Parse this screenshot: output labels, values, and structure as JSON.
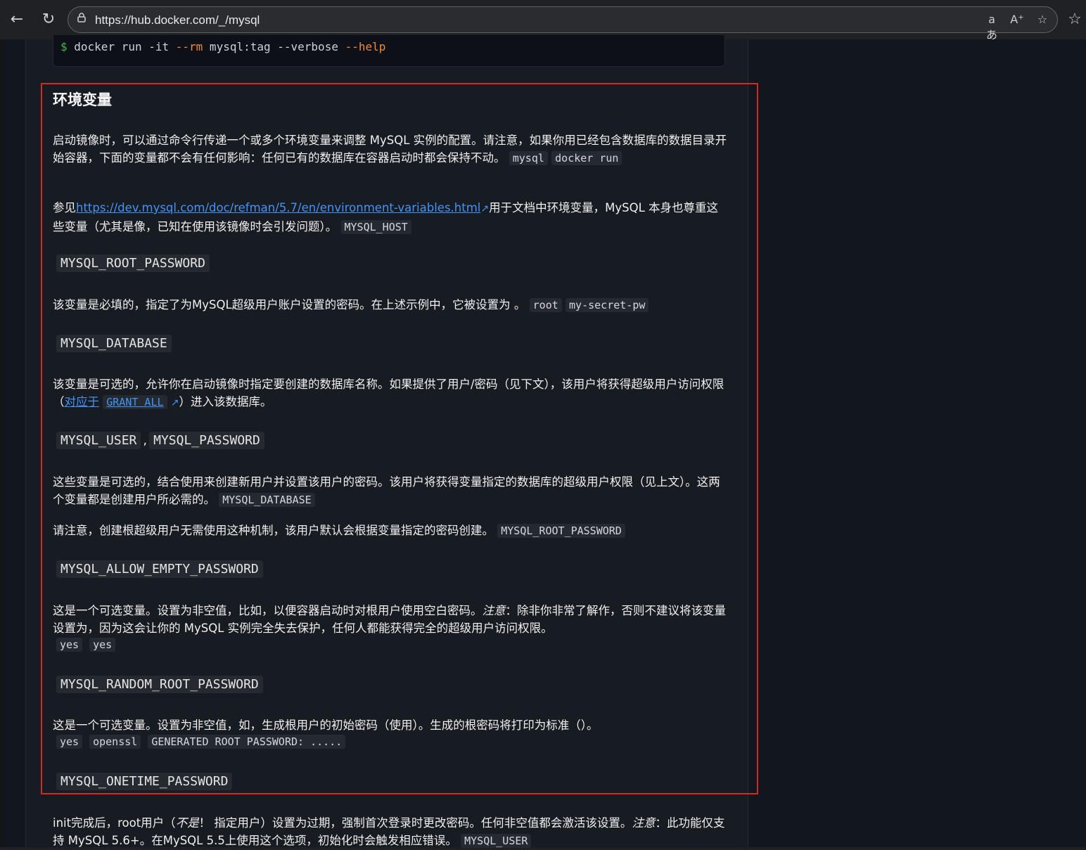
{
  "browser": {
    "url": "https://hub.docker.com/_/mysql",
    "icons": [
      "back-icon",
      "reload-icon",
      "lock-icon",
      "translate-icon",
      "read-aloud-icon",
      "favorite-icon",
      "favorites-list-icon"
    ]
  },
  "code_block": {
    "prompt": "$",
    "cmd_a": " docker run -it ",
    "flag_rm": "--rm",
    "cmd_b": " mysql:tag --verbose ",
    "flag_help": "--help"
  },
  "section": {
    "title": "环境变量",
    "intro_text": "启动镜像时，可以通过命令行传递一个或多个环境变量来调整 MySQL 实例的配置。请注意，如果你用已经包含数据库的数据目录开始容器，下面的变量都不会有任何影响：任何已有的数据库在容器启动时都会保持不动。",
    "intro_code1": "mysql",
    "intro_code2": "docker run",
    "ref_prefix": "参见",
    "ref_link": "https://dev.mysql.com/doc/refman/5.7/en/environment-variables.html",
    "ref_suffix": "用于文档中环境变量，MySQL 本身也尊重这些变量（尤其是像，已知在使用该镜像时会引发问题）。",
    "ref_code": "MYSQL_HOST"
  },
  "vars": {
    "root_password": {
      "name": "MYSQL_ROOT_PASSWORD",
      "desc": "该变量是必填的，指定了为MySQL超级用户账户设置的密码。在上述示例中，它被设置为 。",
      "code1": "root",
      "code2": "my-secret-pw"
    },
    "database": {
      "name": "MYSQL_DATABASE",
      "desc_a": "该变量是可选的，允许你在启动镜像时指定要创建的数据库名称。如果提供了用户/密码（见下文），该用户将获得超级用户访问权限（",
      "link": "对应于",
      "code": "GRANT ALL",
      "desc_b": "）进入该数据库。"
    },
    "user": {
      "name1": "MYSQL_USER",
      "sep": ",",
      "name2": "MYSQL_PASSWORD",
      "desc": "这些变量是可选的，结合使用来创建新用户并设置该用户的密码。该用户将获得变量指定的数据库的超级用户权限（见上文）。这两个变量都是创建用户所必需的。",
      "code": "MYSQL_DATABASE",
      "note": "请注意，创建根超级用户无需使用这种机制，该用户默认会根据变量指定的密码创建。",
      "note_code": "MYSQL_ROOT_PASSWORD"
    },
    "allow_empty": {
      "name": "MYSQL_ALLOW_EMPTY_PASSWORD",
      "desc_a": "这是一个可选变量。设置为非空值，比如，以便容器启动时对根用户使用空白密码。",
      "em": "注意",
      "desc_b": "：除非你非常了解作，否则不建议将该变量设置为，因为这会让你的 MySQL 实例完全失去保护，任何人都能获得完全的超级用户访问权限。",
      "code1": "yes",
      "code2": "yes"
    },
    "random_root": {
      "name": "MYSQL_RANDOM_ROOT_PASSWORD",
      "desc": "这是一个可选变量。设置为非空值，如，生成根用户的初始密码（使用）。生成的根密码将打印为标准（）。",
      "code1": "yes",
      "code2": "openssl",
      "code3": "GENERATED ROOT PASSWORD: ....."
    },
    "onetime": {
      "name": "MYSQL_ONETIME_PASSWORD",
      "desc_a": "init完成后，root用户（",
      "em1": "不是",
      "desc_b": "！ 指定用户）设置为过期，强制首次登录时更改密码。任何非空值都会激活该设置。",
      "em2": "注意",
      "desc_c": "：此功能仅支持 MySQL 5.6+。在MySQL 5.5上使用这个选项，初始化时会触发相应错误。",
      "code": "MYSQL_USER"
    }
  },
  "colors": {
    "highlight_border": "#e02424",
    "link": "#4493f8",
    "background": "#171b22"
  }
}
